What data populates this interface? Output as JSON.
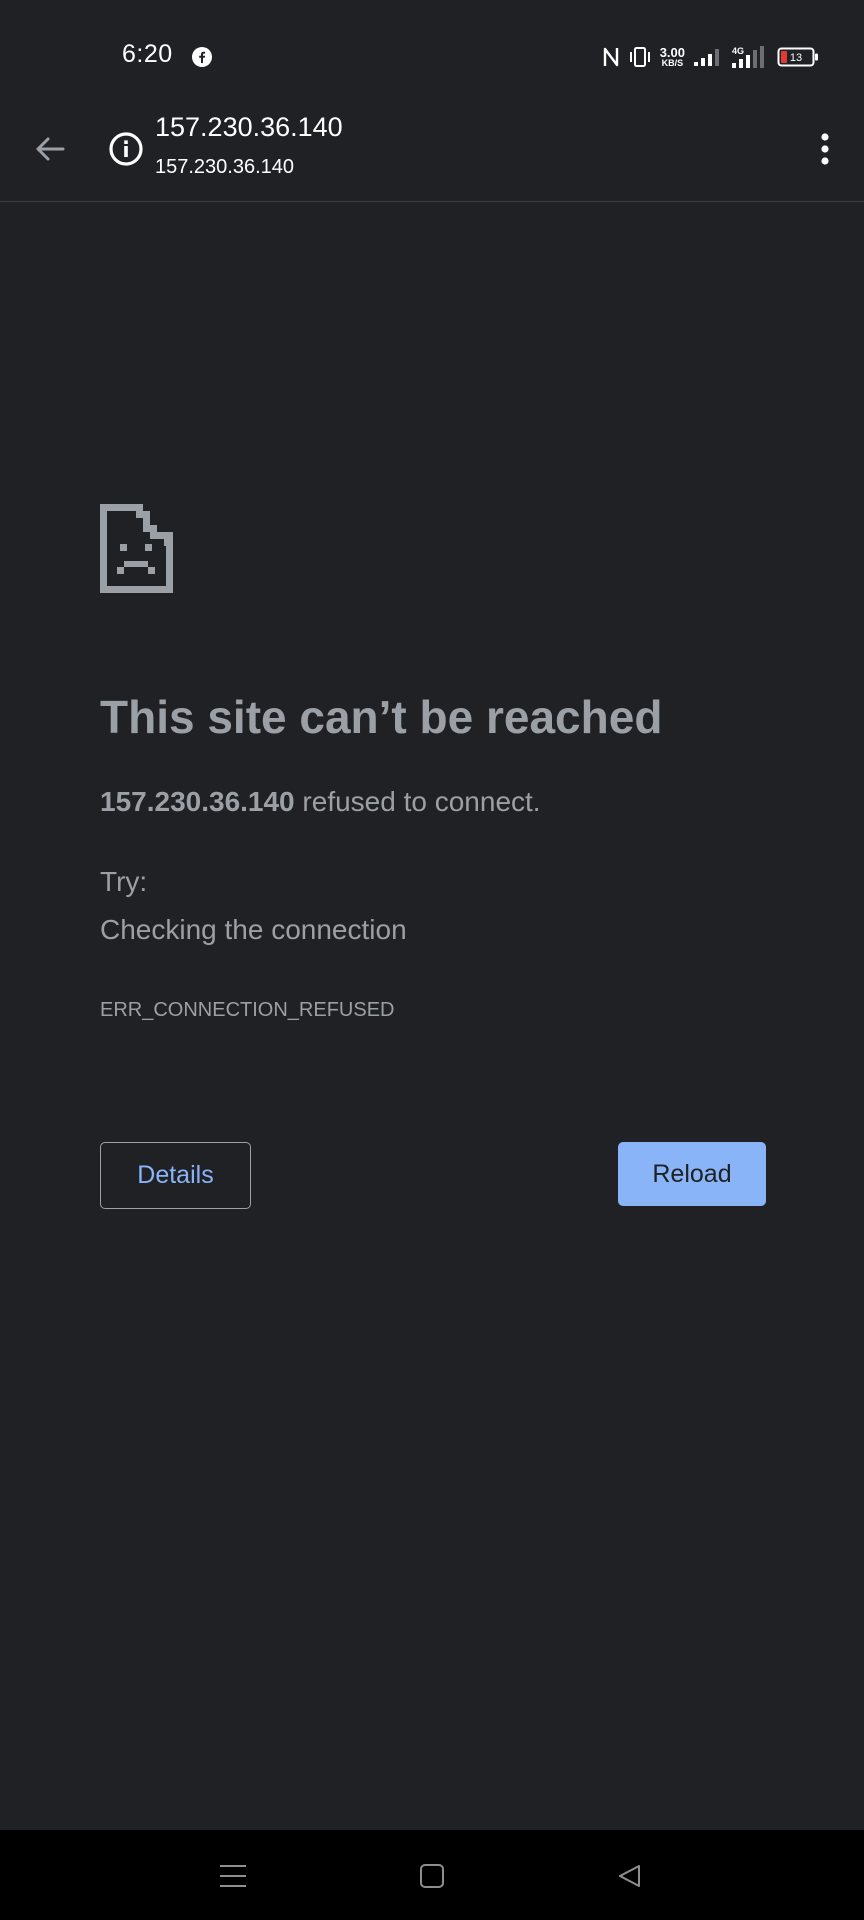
{
  "status_bar": {
    "time": "6:20",
    "notification_icon": "facebook-icon",
    "net_speed_value": "3.00",
    "net_speed_unit": "KB/S",
    "network_type": "4G",
    "battery_level": "13",
    "icons": [
      "nfc-icon",
      "vibrate-icon",
      "signal-icon",
      "signal-4g-icon",
      "battery-icon"
    ]
  },
  "toolbar": {
    "back_icon": "arrow-left-icon",
    "info_icon": "info-icon",
    "title": "157.230.36.140",
    "url": "157.230.36.140",
    "menu_icon": "more-vert-icon"
  },
  "error": {
    "icon": "sad-page-icon",
    "title": "This site can’t be reached",
    "host": "157.230.36.140",
    "message": " refused to connect.",
    "try_label": "Try:",
    "suggestion": "Checking the connection",
    "code": "ERR_CONNECTION_REFUSED",
    "details_label": "Details",
    "reload_label": "Reload"
  },
  "nav_bar": {
    "icons": [
      "menu-icon",
      "home-icon",
      "back-triangle-icon"
    ]
  },
  "colors": {
    "background": "#202124",
    "text_muted": "#9aa0a6",
    "accent": "#8ab4f8",
    "battery_low": "#e53935"
  }
}
